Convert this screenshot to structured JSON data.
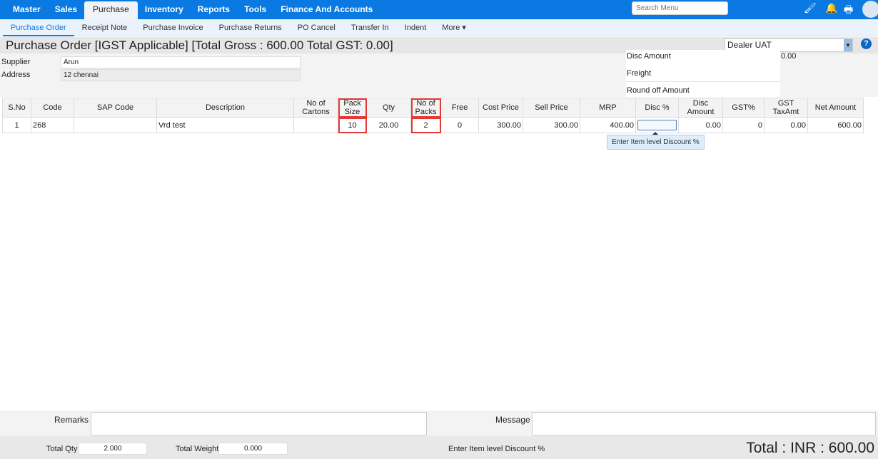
{
  "topnav": {
    "items": [
      "Master",
      "Sales",
      "Purchase",
      "Inventory",
      "Reports",
      "Tools",
      "Finance And Accounts"
    ],
    "search_placeholder": "Search Menu"
  },
  "subnav": {
    "items": [
      "Purchase Order",
      "Receipt Note",
      "Purchase Invoice",
      "Purchase Returns",
      "PO Cancel",
      "Transfer In",
      "Indent",
      "More ▾"
    ]
  },
  "title": "Purchase Order [IGST Applicable] [Total Gross : 600.00 Total GST: 0.00]",
  "dealer": "Dealer UAT",
  "help": "?",
  "form": {
    "supplier_label": "Supplier",
    "supplier": "Arun",
    "address_label": "Address",
    "address": "12 chennai",
    "disc_amount_label": "Disc Amount",
    "disc_amount": "0.00",
    "freight_label": "Freight",
    "roundoff_label": "Round off Amount"
  },
  "table": {
    "headers": [
      "S.No",
      "Code",
      "SAP Code",
      "Description",
      "No of Cartons",
      "Pack Size",
      "Qty",
      "No of Packs",
      "Free",
      "Cost Price",
      "Sell Price",
      "MRP",
      "Disc %",
      "Disc Amount",
      "GST%",
      "GST TaxAmt",
      "Net Amount"
    ],
    "row": [
      "1",
      "268",
      "",
      "Vrd test",
      "",
      "10",
      "20.00",
      "2",
      "0",
      "300.00",
      "300.00",
      "400.00",
      "",
      "0.00",
      "0",
      "0.00",
      "600.00"
    ]
  },
  "tooltip": "Enter Item level Discount %",
  "footer": {
    "remarks_label": "Remarks",
    "message_label": "Message",
    "total_qty_label": "Total Qty",
    "total_qty": "2.000",
    "total_weight_label": "Total Weight",
    "total_weight": "0.000",
    "hint": "Enter Item level Discount %",
    "total": "Total : INR : 600.00"
  }
}
